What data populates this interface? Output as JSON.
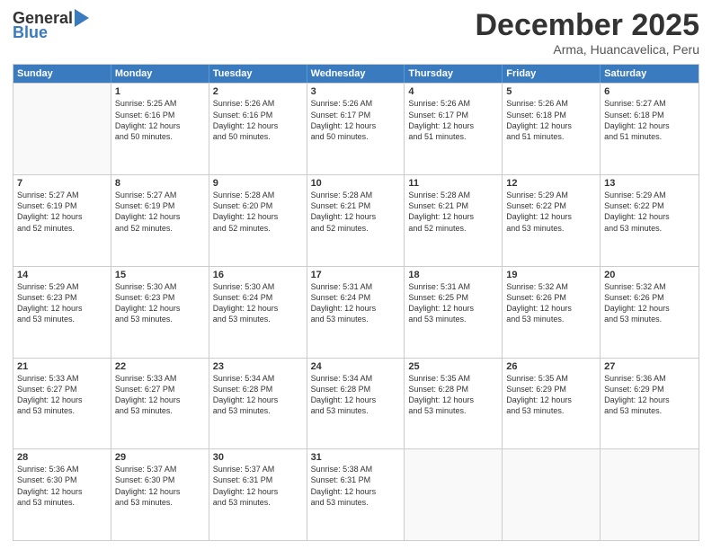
{
  "logo": {
    "general": "General",
    "blue": "Blue"
  },
  "title": "December 2025",
  "subtitle": "Arma, Huancavelica, Peru",
  "header_days": [
    "Sunday",
    "Monday",
    "Tuesday",
    "Wednesday",
    "Thursday",
    "Friday",
    "Saturday"
  ],
  "weeks": [
    [
      {
        "day": "",
        "lines": []
      },
      {
        "day": "1",
        "lines": [
          "Sunrise: 5:25 AM",
          "Sunset: 6:16 PM",
          "Daylight: 12 hours",
          "and 50 minutes."
        ]
      },
      {
        "day": "2",
        "lines": [
          "Sunrise: 5:26 AM",
          "Sunset: 6:16 PM",
          "Daylight: 12 hours",
          "and 50 minutes."
        ]
      },
      {
        "day": "3",
        "lines": [
          "Sunrise: 5:26 AM",
          "Sunset: 6:17 PM",
          "Daylight: 12 hours",
          "and 50 minutes."
        ]
      },
      {
        "day": "4",
        "lines": [
          "Sunrise: 5:26 AM",
          "Sunset: 6:17 PM",
          "Daylight: 12 hours",
          "and 51 minutes."
        ]
      },
      {
        "day": "5",
        "lines": [
          "Sunrise: 5:26 AM",
          "Sunset: 6:18 PM",
          "Daylight: 12 hours",
          "and 51 minutes."
        ]
      },
      {
        "day": "6",
        "lines": [
          "Sunrise: 5:27 AM",
          "Sunset: 6:18 PM",
          "Daylight: 12 hours",
          "and 51 minutes."
        ]
      }
    ],
    [
      {
        "day": "7",
        "lines": [
          "Sunrise: 5:27 AM",
          "Sunset: 6:19 PM",
          "Daylight: 12 hours",
          "and 52 minutes."
        ]
      },
      {
        "day": "8",
        "lines": [
          "Sunrise: 5:27 AM",
          "Sunset: 6:19 PM",
          "Daylight: 12 hours",
          "and 52 minutes."
        ]
      },
      {
        "day": "9",
        "lines": [
          "Sunrise: 5:28 AM",
          "Sunset: 6:20 PM",
          "Daylight: 12 hours",
          "and 52 minutes."
        ]
      },
      {
        "day": "10",
        "lines": [
          "Sunrise: 5:28 AM",
          "Sunset: 6:21 PM",
          "Daylight: 12 hours",
          "and 52 minutes."
        ]
      },
      {
        "day": "11",
        "lines": [
          "Sunrise: 5:28 AM",
          "Sunset: 6:21 PM",
          "Daylight: 12 hours",
          "and 52 minutes."
        ]
      },
      {
        "day": "12",
        "lines": [
          "Sunrise: 5:29 AM",
          "Sunset: 6:22 PM",
          "Daylight: 12 hours",
          "and 53 minutes."
        ]
      },
      {
        "day": "13",
        "lines": [
          "Sunrise: 5:29 AM",
          "Sunset: 6:22 PM",
          "Daylight: 12 hours",
          "and 53 minutes."
        ]
      }
    ],
    [
      {
        "day": "14",
        "lines": [
          "Sunrise: 5:29 AM",
          "Sunset: 6:23 PM",
          "Daylight: 12 hours",
          "and 53 minutes."
        ]
      },
      {
        "day": "15",
        "lines": [
          "Sunrise: 5:30 AM",
          "Sunset: 6:23 PM",
          "Daylight: 12 hours",
          "and 53 minutes."
        ]
      },
      {
        "day": "16",
        "lines": [
          "Sunrise: 5:30 AM",
          "Sunset: 6:24 PM",
          "Daylight: 12 hours",
          "and 53 minutes."
        ]
      },
      {
        "day": "17",
        "lines": [
          "Sunrise: 5:31 AM",
          "Sunset: 6:24 PM",
          "Daylight: 12 hours",
          "and 53 minutes."
        ]
      },
      {
        "day": "18",
        "lines": [
          "Sunrise: 5:31 AM",
          "Sunset: 6:25 PM",
          "Daylight: 12 hours",
          "and 53 minutes."
        ]
      },
      {
        "day": "19",
        "lines": [
          "Sunrise: 5:32 AM",
          "Sunset: 6:26 PM",
          "Daylight: 12 hours",
          "and 53 minutes."
        ]
      },
      {
        "day": "20",
        "lines": [
          "Sunrise: 5:32 AM",
          "Sunset: 6:26 PM",
          "Daylight: 12 hours",
          "and 53 minutes."
        ]
      }
    ],
    [
      {
        "day": "21",
        "lines": [
          "Sunrise: 5:33 AM",
          "Sunset: 6:27 PM",
          "Daylight: 12 hours",
          "and 53 minutes."
        ]
      },
      {
        "day": "22",
        "lines": [
          "Sunrise: 5:33 AM",
          "Sunset: 6:27 PM",
          "Daylight: 12 hours",
          "and 53 minutes."
        ]
      },
      {
        "day": "23",
        "lines": [
          "Sunrise: 5:34 AM",
          "Sunset: 6:28 PM",
          "Daylight: 12 hours",
          "and 53 minutes."
        ]
      },
      {
        "day": "24",
        "lines": [
          "Sunrise: 5:34 AM",
          "Sunset: 6:28 PM",
          "Daylight: 12 hours",
          "and 53 minutes."
        ]
      },
      {
        "day": "25",
        "lines": [
          "Sunrise: 5:35 AM",
          "Sunset: 6:28 PM",
          "Daylight: 12 hours",
          "and 53 minutes."
        ]
      },
      {
        "day": "26",
        "lines": [
          "Sunrise: 5:35 AM",
          "Sunset: 6:29 PM",
          "Daylight: 12 hours",
          "and 53 minutes."
        ]
      },
      {
        "day": "27",
        "lines": [
          "Sunrise: 5:36 AM",
          "Sunset: 6:29 PM",
          "Daylight: 12 hours",
          "and 53 minutes."
        ]
      }
    ],
    [
      {
        "day": "28",
        "lines": [
          "Sunrise: 5:36 AM",
          "Sunset: 6:30 PM",
          "Daylight: 12 hours",
          "and 53 minutes."
        ]
      },
      {
        "day": "29",
        "lines": [
          "Sunrise: 5:37 AM",
          "Sunset: 6:30 PM",
          "Daylight: 12 hours",
          "and 53 minutes."
        ]
      },
      {
        "day": "30",
        "lines": [
          "Sunrise: 5:37 AM",
          "Sunset: 6:31 PM",
          "Daylight: 12 hours",
          "and 53 minutes."
        ]
      },
      {
        "day": "31",
        "lines": [
          "Sunrise: 5:38 AM",
          "Sunset: 6:31 PM",
          "Daylight: 12 hours",
          "and 53 minutes."
        ]
      },
      {
        "day": "",
        "lines": []
      },
      {
        "day": "",
        "lines": []
      },
      {
        "day": "",
        "lines": []
      }
    ]
  ]
}
